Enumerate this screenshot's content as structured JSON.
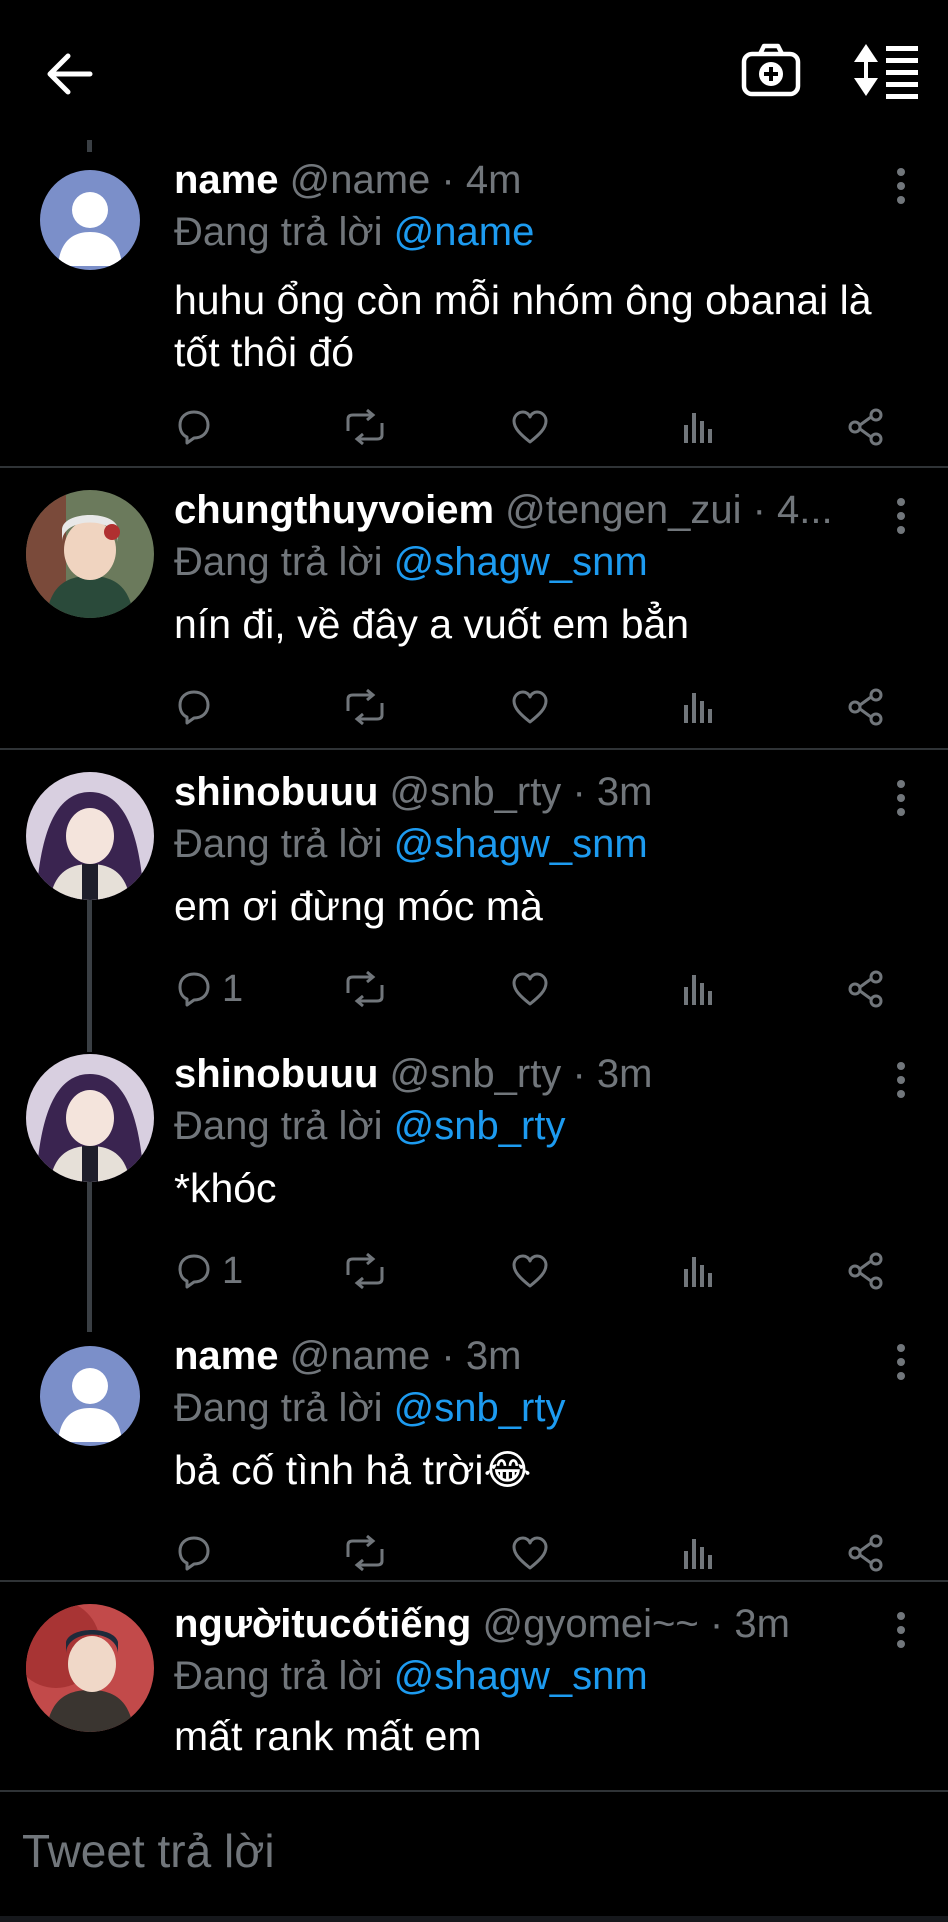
{
  "header": {
    "back_icon": "arrow-left-icon",
    "camera_icon": "camera-plus-icon",
    "sort_icon": "sort-thread-icon"
  },
  "reply_prefix": "Đang trả lời",
  "tweets": [
    {
      "name": "name",
      "handle": "@name",
      "time": "· 4m",
      "reply_to": "@name",
      "text": "huhu ổng còn mỗi nhóm ông obanai là tốt thôi đó",
      "replies": ""
    },
    {
      "name": "chungthuyvoiem",
      "handle": "@tengen_zui",
      "time": "· 4...",
      "reply_to": "@shagw_snm",
      "text": "nín đi, về đây a vuốt em bẳn",
      "replies": ""
    },
    {
      "name": "shinobuuu",
      "handle": "@snb_rty",
      "time": "· 3m",
      "reply_to": "@shagw_snm",
      "text": "em ơi đừng móc mà",
      "replies": "1"
    },
    {
      "name": "shinobuuu",
      "handle": "@snb_rty",
      "time": "· 3m",
      "reply_to": "@snb_rty",
      "text": "*khóc",
      "replies": "1"
    },
    {
      "name": "name",
      "handle": "@name",
      "time": "· 3m",
      "reply_to": "@snb_rty",
      "text": "bả cố tình hả trời😂",
      "replies": ""
    },
    {
      "name": "ngườitucótiếng",
      "handle": "@gyomei~~",
      "time": "· 3m",
      "reply_to": "@shagw_snm",
      "text": "mất rank mất em",
      "replies": ""
    }
  ],
  "composer": {
    "placeholder": "Tweet trả lời"
  },
  "colors": {
    "background": "#000000",
    "accent": "#1d9bf0",
    "muted": "#71767b",
    "divider": "#2f3336"
  }
}
